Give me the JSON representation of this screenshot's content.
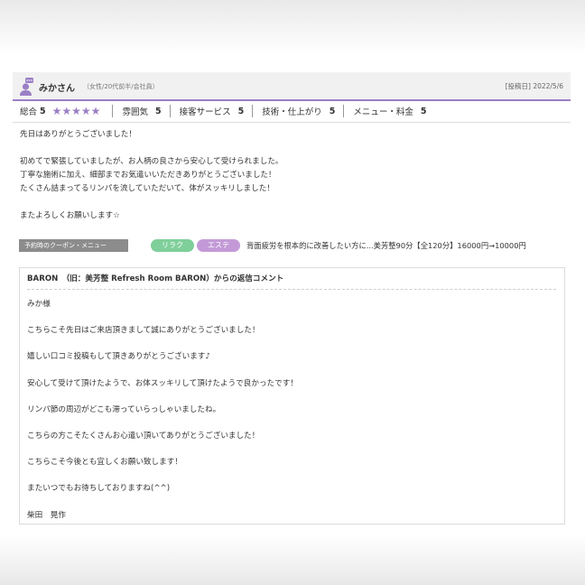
{
  "review": {
    "reviewer_name": "みかさん",
    "reviewer_meta": "（女性/20代前半/会社員）",
    "post_date": "[投稿日] 2022/5/6",
    "overall_label": "総合",
    "overall_value": "5",
    "overall_stars": "★★★★★",
    "ratings": [
      {
        "label": "雰囲気",
        "value": "5"
      },
      {
        "label": "接客サービス",
        "value": "5"
      },
      {
        "label": "技術・仕上がり",
        "value": "5"
      },
      {
        "label": "メニュー・料金",
        "value": "5"
      }
    ],
    "body": [
      "先日はありがとうございました！",
      "",
      "初めてで緊張していましたが、お人柄の良さから安心して受けられました。",
      "丁寧な施術に加え、細部までお気遣いいただきありがとうございました！",
      "たくさん詰まってるリンパを流していただいて、体がスッキリしました！",
      "",
      "またよろしくお願いします☆"
    ]
  },
  "coupon": {
    "label": "予約時のクーポン・メニュー",
    "tags": [
      "リラク",
      "エステ"
    ],
    "text": "背面疲労を根本的に改善したい方に...美芳整90分【全120分】16000円→10000円"
  },
  "reply": {
    "title": "BARON　（旧：美芳整 Refresh Room BARON）からの返信コメント",
    "lines": [
      "みか様",
      "こちらこそ先日はご来店頂きまして誠にありがとうございました！",
      "嬉しい口コミ投稿もして頂きありがとうございます♪",
      "安心して受けて頂けたようで、お体スッキリして頂けたようで良かったです！",
      "リンパ節の周辺がどこも滞っていらっしゃいましたね。",
      "こちらの方こそたくさんお心遣い頂いてありがとうございました！",
      "こちらこそ今後とも宜しくお願い致します！",
      "またいつでもお待ちしておりますね(^^)",
      "柴田　晃作"
    ]
  },
  "colors": {
    "accent_purple": "#9b7fc5",
    "tag_green": "#7fcf9a",
    "tag_purple": "#c39ad7",
    "coupon_label_bg": "#8c8c8c"
  }
}
